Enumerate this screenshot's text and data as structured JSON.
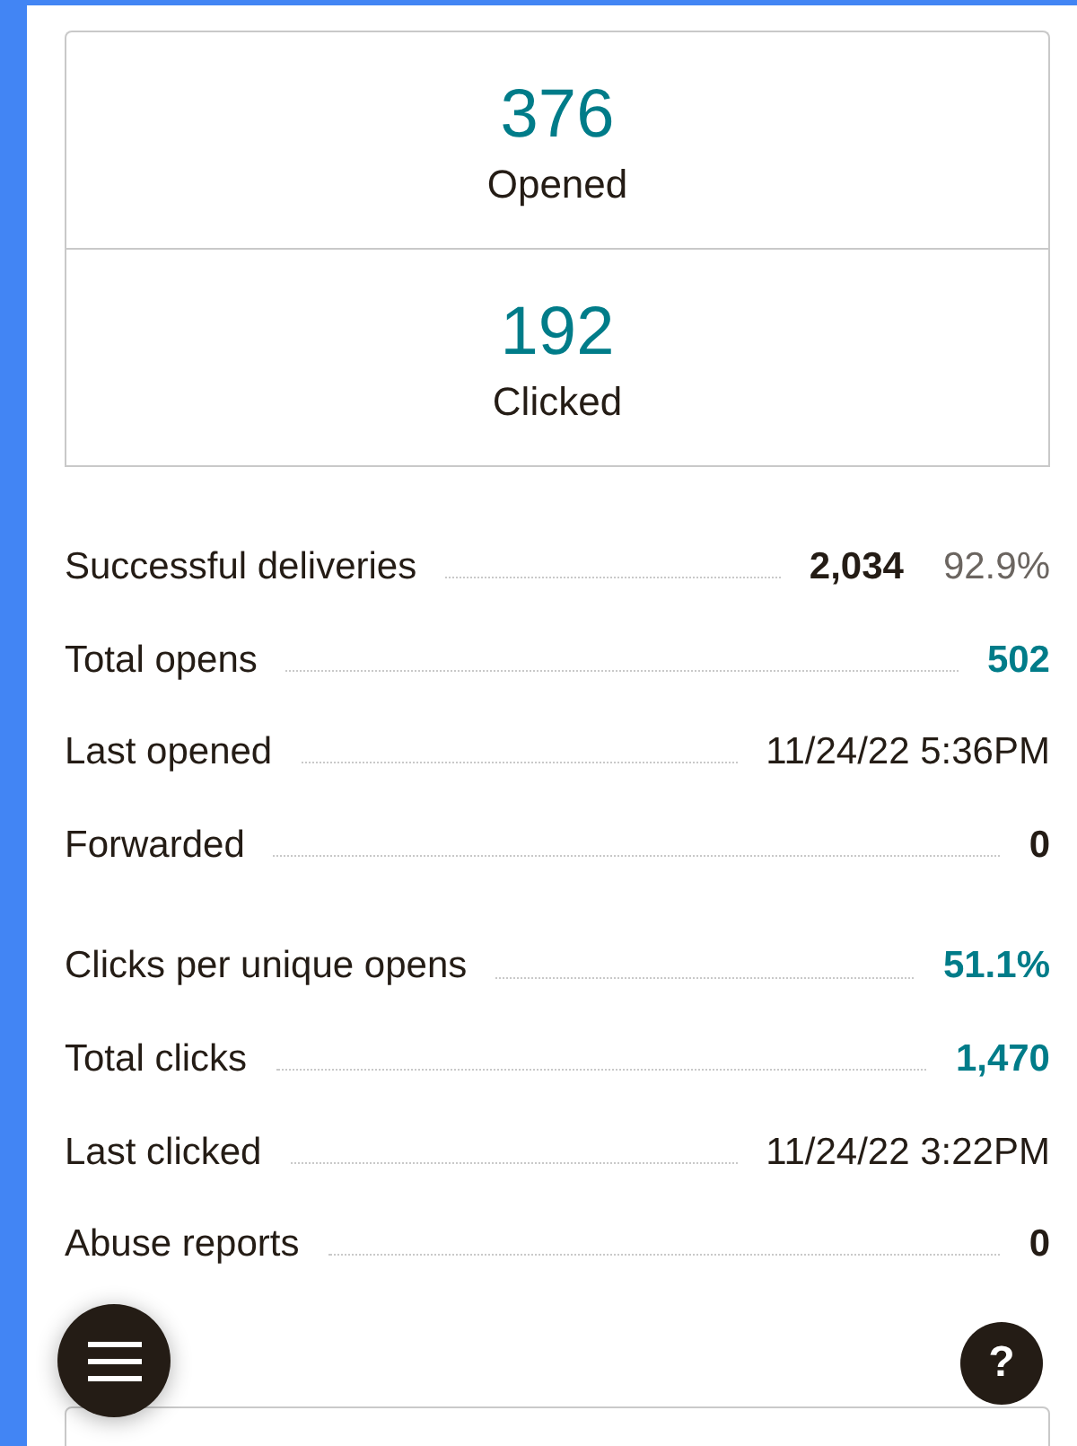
{
  "summary_cards": [
    {
      "count": "376",
      "label": "Opened"
    },
    {
      "count": "192",
      "label": "Clicked"
    }
  ],
  "stat_groups": [
    {
      "rows": [
        {
          "label": "Successful deliveries",
          "values": [
            {
              "text": "2,034",
              "kind": "bold"
            },
            {
              "text": "92.9%",
              "kind": "muted"
            }
          ]
        },
        {
          "label": "Total opens",
          "values": [
            {
              "text": "502",
              "kind": "link"
            }
          ]
        },
        {
          "label": "Last opened",
          "values": [
            {
              "text": "11/24/22 5:36PM",
              "kind": "plain"
            }
          ]
        },
        {
          "label": "Forwarded",
          "values": [
            {
              "text": "0",
              "kind": "bold"
            }
          ]
        }
      ]
    },
    {
      "rows": [
        {
          "label": "Clicks per unique opens",
          "values": [
            {
              "text": "51.1%",
              "kind": "link"
            }
          ]
        },
        {
          "label": "Total clicks",
          "values": [
            {
              "text": "1,470",
              "kind": "link"
            }
          ]
        },
        {
          "label": "Last clicked",
          "values": [
            {
              "text": "11/24/22 3:22PM",
              "kind": "plain"
            }
          ]
        },
        {
          "label": "Abuse reports",
          "values": [
            {
              "text": "0",
              "kind": "bold"
            }
          ]
        }
      ]
    }
  ],
  "help_button": {
    "text": "?"
  }
}
